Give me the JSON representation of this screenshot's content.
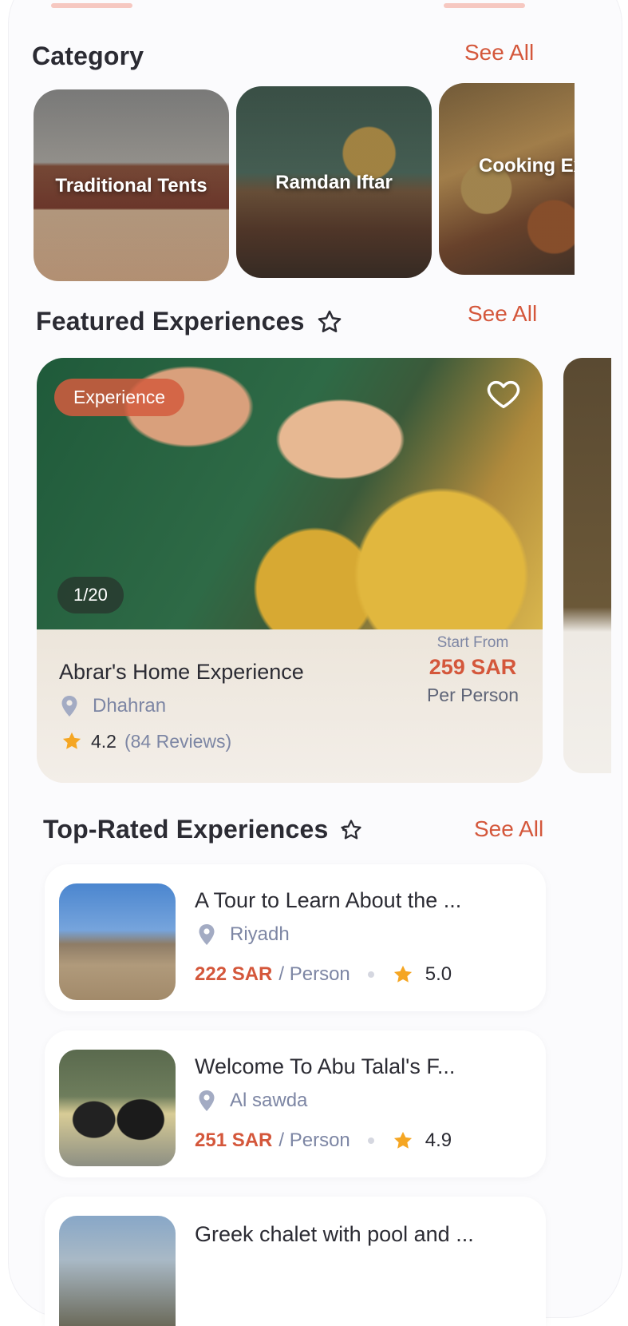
{
  "category": {
    "title": "Category",
    "see_all": "See All",
    "items": [
      {
        "label": "Traditional Tents"
      },
      {
        "label": "Ramdan Iftar"
      },
      {
        "label": "Cooking Experience"
      }
    ]
  },
  "featured": {
    "title": "Featured Experiences",
    "see_all": "See All",
    "card": {
      "badge": "Experience",
      "counter": "1/20",
      "name": "Abrar's Home Experience",
      "location": "Dhahran",
      "rating": "4.2",
      "reviews": "(84 Reviews)",
      "start_from": "Start From",
      "price": "259 SAR",
      "per": "Per Person"
    }
  },
  "top_rated": {
    "title": "Top-Rated Experiences",
    "see_all": "See All",
    "items": [
      {
        "name": "A Tour to Learn About the ...",
        "location": "Riyadh",
        "price": "222 SAR",
        "per": "/ Person",
        "rating": "5.0"
      },
      {
        "name": "Welcome To Abu Talal's F...",
        "location": "Al sawda",
        "price": "251 SAR",
        "per": "/ Person",
        "rating": "4.9"
      },
      {
        "name": "Greek chalet with pool and ..."
      }
    ]
  },
  "colors": {
    "accent": "#d4573b",
    "muted": "#7d86a4",
    "star": "#f5a623"
  }
}
